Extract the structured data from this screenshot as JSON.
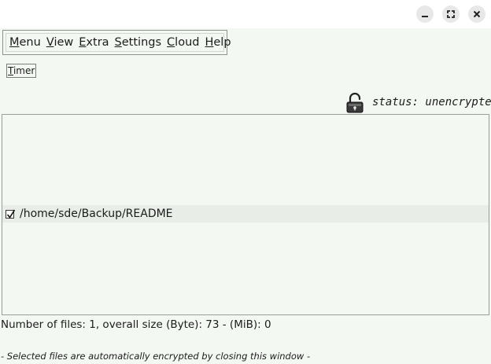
{
  "window_controls": {
    "minimize_icon": "minimize-icon",
    "maximize_icon": "maximize-icon",
    "close_icon": "close-icon"
  },
  "menubar": {
    "items": [
      {
        "mnemonic": "M",
        "rest": "enu"
      },
      {
        "mnemonic": "V",
        "rest": "iew"
      },
      {
        "mnemonic": "E",
        "rest": "xtra"
      },
      {
        "mnemonic": "S",
        "rest": "ettings"
      },
      {
        "mnemonic": "C",
        "rest": "loud"
      },
      {
        "mnemonic": "H",
        "rest": "elp"
      }
    ]
  },
  "toolbar": {
    "timer_mnemonic": "T",
    "timer_rest": "imer"
  },
  "status": {
    "icon": "unlocked-padlock-icon",
    "text": "status: unencrypted"
  },
  "file_list": {
    "rows": [
      {
        "checked": true,
        "path": "/home/sde/Backup/README"
      }
    ]
  },
  "summary": "Number of files: 1, overall size (Byte): 73 - (MiB): 0",
  "hint": "- Selected files are automatically encrypted by closing this window -",
  "colors": {
    "background": "#f3f8f2",
    "titlebar": "#ffffff",
    "row_highlight": "#e8eee7"
  }
}
